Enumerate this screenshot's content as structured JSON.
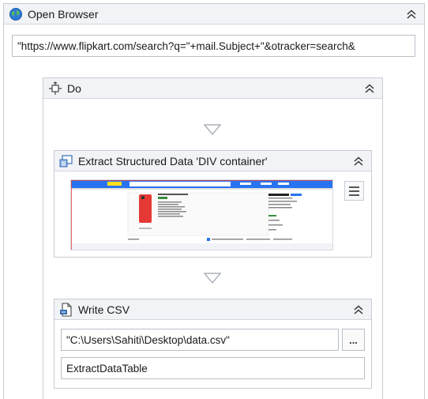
{
  "open_browser": {
    "title": "Open Browser",
    "url_value": "\"https://www.flipkart.com/search?q=\"+mail.Subject+\"&otracker=search&"
  },
  "do_block": {
    "title": "Do"
  },
  "extract": {
    "title": "Extract Structured Data 'DIV  container'"
  },
  "write_csv": {
    "title": "Write CSV",
    "path_value": "\"C:\\Users\\Sahiti\\Desktop\\data.csv\"",
    "browse_label": "...",
    "datatable_value": "ExtractDataTable"
  },
  "colors": {
    "header_bg": "#f1f3f6",
    "border": "#c8ccd3",
    "thumb_blue": "#2874f0",
    "thumb_red": "#e53935"
  }
}
